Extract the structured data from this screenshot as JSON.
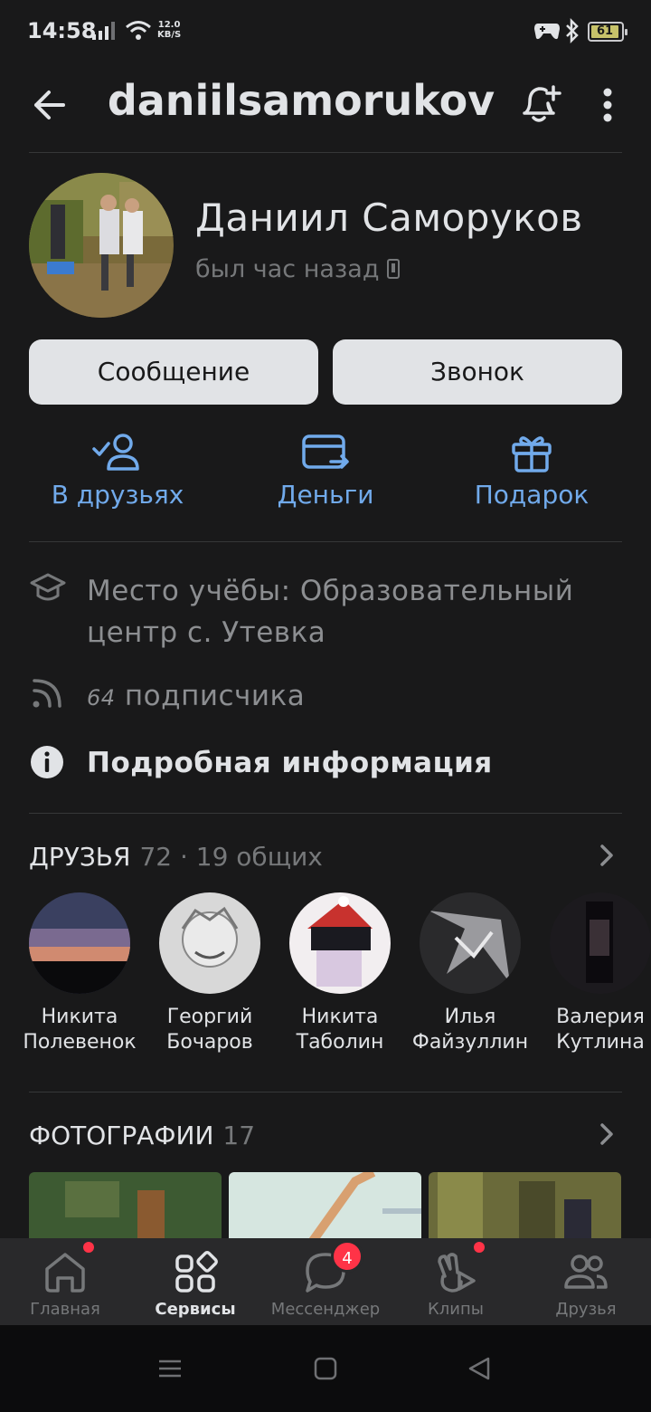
{
  "status_bar": {
    "time": "14:58",
    "net_speed_value": "12.0",
    "net_speed_unit": "KB/S",
    "battery_level": "61"
  },
  "header": {
    "title": "daniilsamorukov"
  },
  "profile": {
    "name": "Даниил  Саморуков",
    "last_seen": "был  час  назад",
    "message_button": "Сообщение",
    "call_button": "Звонок"
  },
  "actions": [
    {
      "label": "В  друзьях",
      "icon": "friend-added-icon"
    },
    {
      "label": "Деньги",
      "icon": "money-transfer-icon"
    },
    {
      "label": "Подарок",
      "icon": "gift-icon"
    }
  ],
  "info": {
    "education": "Место  учёбы:  Образовательный  центр  с.  Утевка",
    "followers_count": "64",
    "followers_label": "подписчика",
    "details": "Подробная информация"
  },
  "friends": {
    "title": "ДРУЗЬЯ",
    "count": "72 · 19 общих",
    "items": [
      {
        "first": "Никита",
        "last": "Полевенок"
      },
      {
        "first": "Георгий",
        "last": "Бочаров"
      },
      {
        "first": "Никита",
        "last": "Таболин"
      },
      {
        "first": "Илья",
        "last": "Файзуллин"
      },
      {
        "first": "Валерия",
        "last": "Кутлина"
      }
    ]
  },
  "photos": {
    "title": "ФОТОГРАФИИ",
    "count": "17"
  },
  "tabbar": {
    "items": [
      {
        "label": "Главная",
        "icon": "home-icon",
        "active": false,
        "dot": true
      },
      {
        "label": "Сервисы",
        "icon": "services-icon",
        "active": true
      },
      {
        "label": "Мессенджер",
        "icon": "messenger-icon",
        "active": false,
        "badge": "4"
      },
      {
        "label": "Клипы",
        "icon": "clips-icon",
        "active": false,
        "dot": true
      },
      {
        "label": "Друзья",
        "icon": "friends-icon",
        "active": false
      }
    ]
  },
  "colors": {
    "accent": "#71aaeb",
    "background": "#19191a",
    "badge": "#ff3347",
    "button": "#e1e3e6"
  }
}
